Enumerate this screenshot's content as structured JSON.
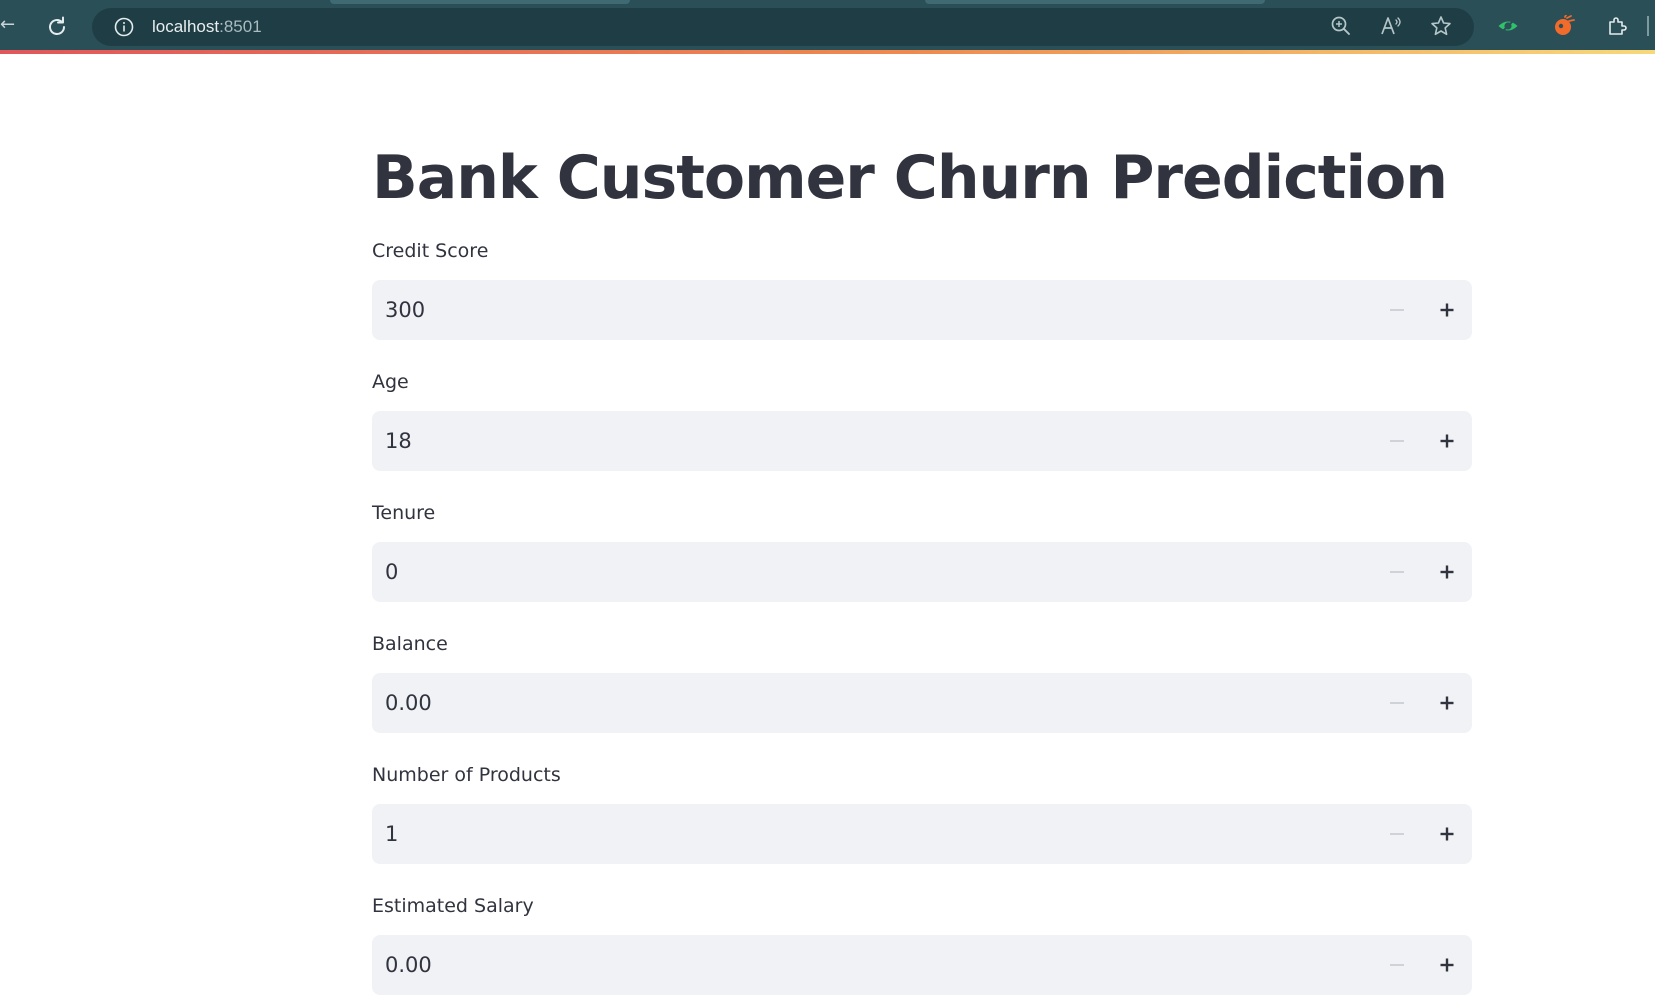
{
  "browser": {
    "url_host": "localhost",
    "url_port": ":8501",
    "icons": [
      "back-icon",
      "reload-icon",
      "site-info-icon",
      "zoom-icon",
      "read-aloud-icon",
      "favorite-star-icon",
      "eye-extension-icon",
      "orange-extension-icon",
      "extensions-puzzle-icon"
    ]
  },
  "app": {
    "title": "Bank Customer Churn Prediction"
  },
  "fields": [
    {
      "label": "Credit Score",
      "value": "300"
    },
    {
      "label": "Age",
      "value": "18"
    },
    {
      "label": "Tenure",
      "value": "0"
    },
    {
      "label": "Balance",
      "value": "0.00"
    },
    {
      "label": "Number of Products",
      "value": "1"
    },
    {
      "label": "Estimated Salary",
      "value": "0.00"
    }
  ],
  "colors": {
    "browser_bar": "#2b4f57",
    "address_bar": "#1f3d44",
    "input_bg": "#f0f2f6",
    "text": "#31333f",
    "minus_disabled": "#c9cbd2",
    "eye_extension": "#2fc26b",
    "orange_extension": "#f26b2a"
  }
}
